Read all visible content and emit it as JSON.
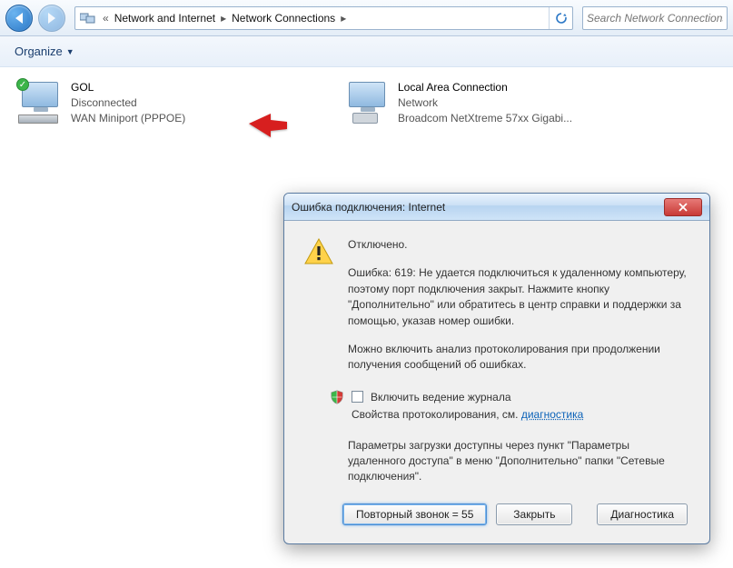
{
  "nav": {
    "crumb1": "Network and Internet",
    "crumb2": "Network Connections",
    "search_placeholder": "Search Network Connections"
  },
  "organize": {
    "label": "Organize"
  },
  "connections": {
    "gol": {
      "title": "GOL",
      "status": "Disconnected",
      "device": "WAN Miniport (PPPOE)"
    },
    "lan": {
      "title": "Local Area Connection",
      "status": "Network",
      "device": "Broadcom NetXtreme 57xx Gigabi..."
    }
  },
  "dialog": {
    "title": "Ошибка подключения: Internet",
    "status": "Отключено.",
    "error_text": "Ошибка: 619: Не удается подключиться к удаленному компьютеру, поэтому порт подключения закрыт. Нажмите кнопку \"Дополнительно\" или обратитесь в центр справки и поддержки за помощью, указав номер ошибки.",
    "note": "Можно включить анализ протоколирования при продолжении получения сообщений об ошибках.",
    "log_checkbox_label": "Включить ведение журнала",
    "log_line2_prefix": "Свойства протоколирования, см. ",
    "log_link": "диагностика",
    "params": "Параметры загрузки доступны через пункт \"Параметры удаленного доступа\" в меню \"Дополнительно\" папки \"Сетевые подключения\".",
    "buttons": {
      "redial": "Повторный звонок = 55",
      "close": "Закрыть",
      "diag": "Диагностика"
    }
  }
}
